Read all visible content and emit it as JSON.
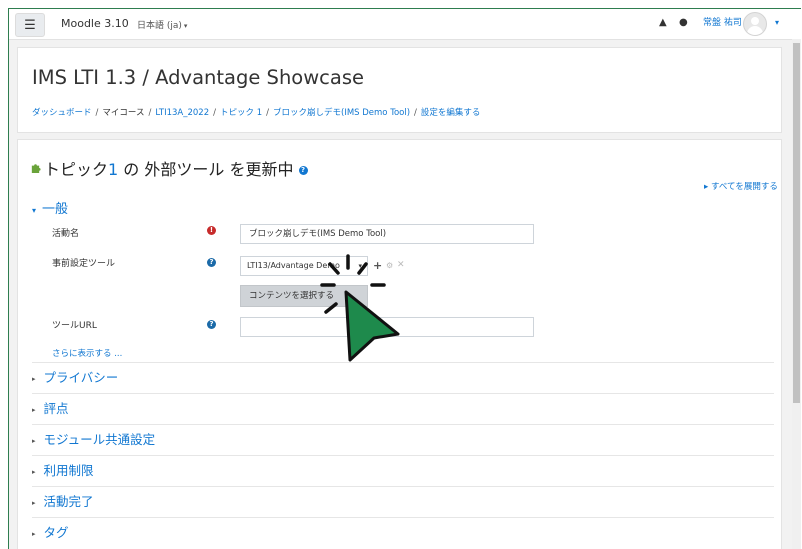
{
  "navbar": {
    "menu_icon": "hamburger-icon",
    "site_name": "Moodle 3.10",
    "language": "日本語 ‎(ja)‎",
    "language_caret": "▾",
    "bell_icon": "▲",
    "chat_icon": "●",
    "user_name": "常盤 祐司",
    "user_caret": "▾"
  },
  "header": {
    "title": "IMS LTI 1.3 / Advantage Showcase",
    "breadcrumb": [
      "ダッシュボード",
      "マイコース",
      "LTI13A_2022",
      "トピック 1",
      "ブロック崩しデモ(IMS Demo Tool)",
      "設定を編集する"
    ],
    "breadcrumb_sep": "/"
  },
  "form": {
    "title_prefix": "トピック",
    "title_num": "1",
    "title_suffix": "の 外部ツール を更新中",
    "help_glyph": "?",
    "expand_all": "▸ すべてを展開する",
    "general_section": "一般",
    "general_triangle": "▾",
    "activity_name_label": "活動名",
    "required_glyph": "!",
    "activity_name_value": "ブロック崩しデモ(IMS Demo Tool)",
    "preconfigured_tool_label": "事前設定ツール",
    "preconfigured_tool_value": "LTI13/Advantage Demo",
    "select_caret": "▾",
    "plus_glyph": "+",
    "gear_glyph": "⚙",
    "close_glyph": "✕",
    "select_content_button": "コンテンツを選択する",
    "tool_url_label": "ツールURL",
    "tool_url_value": "",
    "show_more": "さらに表示する ...",
    "collapsed_triangle": "▸",
    "collapsed_sections": [
      "プライバシー",
      "評点",
      "モジュール共通設定",
      "利用制限",
      "活動完了",
      "タグ"
    ]
  },
  "colors": {
    "link": "#1177d1",
    "cursor_fill": "#1e8a4c",
    "required": "#c72b2b",
    "frame_border": "#2e7d4f"
  }
}
